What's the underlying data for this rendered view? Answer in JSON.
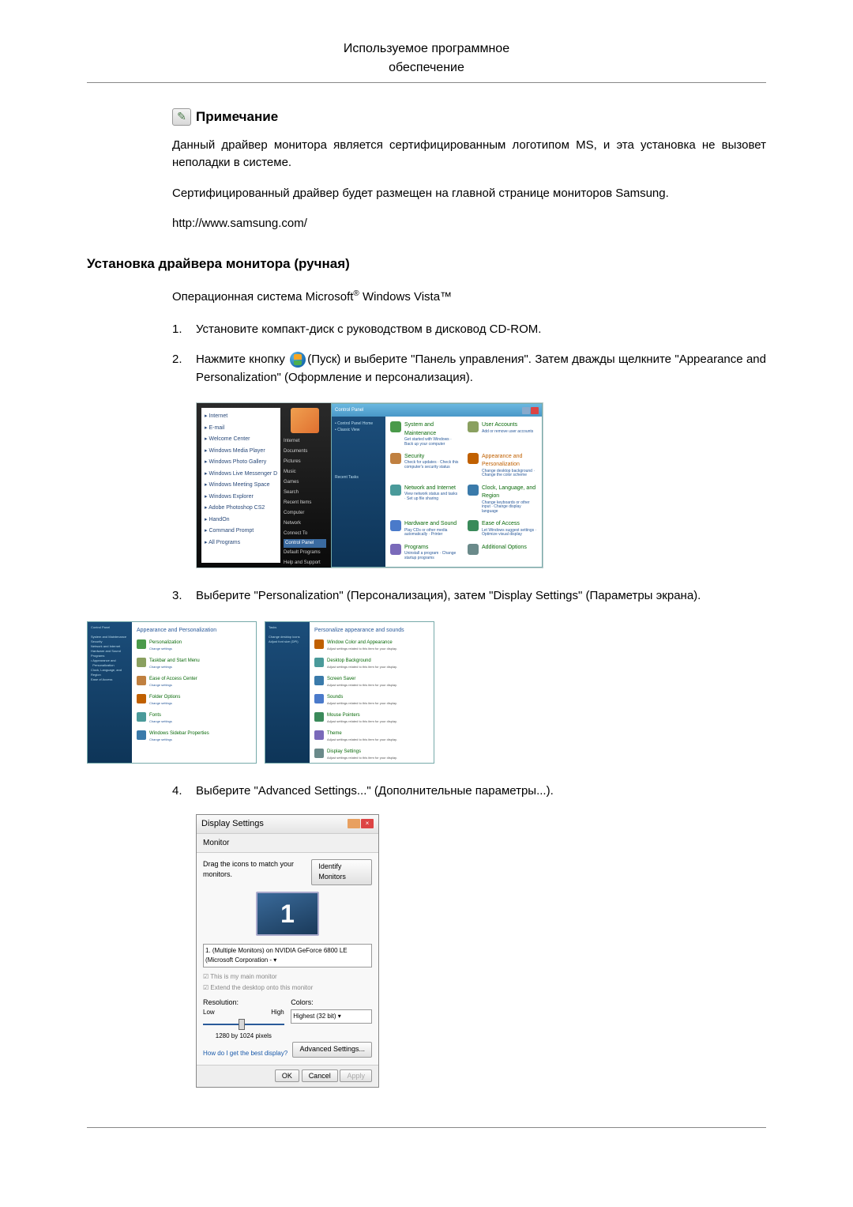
{
  "header": {
    "line1": "Используемое программное",
    "line2": "обеспечение"
  },
  "note": {
    "heading": "Примечание",
    "icon_glyph": "✎",
    "p1": "Данный драйвер монитора является сертифицированным логотипом MS, и эта установка не вызовет неполадки в системе.",
    "p2": "Сертифицированный драйвер будет размещен на главной странице мониторов Samsung.",
    "url": "http://www.samsung.com/"
  },
  "section_title": "Установка драйвера монитора (ручная)",
  "os_line_pre": "Операционная система Microsoft",
  "os_reg": "®",
  "os_line_mid": " Windows Vista™",
  "steps": {
    "s1": {
      "num": "1.",
      "text": "Установите компакт-диск с руководством в дисковод CD-ROM."
    },
    "s2": {
      "num": "2.",
      "pre": "Нажмите кнопку ",
      "post": "(Пуск) и выберите \"Панель управления\". Затем дважды щелкните \"Appearance and Personalization\" (Оформление и персонализация)."
    },
    "s3": {
      "num": "3.",
      "text": "Выберите \"Personalization\" (Персонализация), затем \"Display Settings\" (Параметры экрана)."
    },
    "s4": {
      "num": "4.",
      "text": "Выберите \"Advanced Settings...\" (Дополнительные параметры...)."
    }
  },
  "startmenu_shot": {
    "left_items": [
      "Internet",
      "E-mail",
      "Welcome Center",
      "Windows Media Player",
      "Windows Photo Gallery",
      "Windows Live Messenger Download",
      "Windows Meeting Space",
      "Windows Explorer",
      "Adobe Photoshop CS2",
      "HandOn",
      "Command Prompt",
      "All Programs"
    ],
    "right_items": [
      "Internet",
      "Documents",
      "Pictures",
      "Music",
      "Games",
      "Search",
      "Recent Items",
      "Computer",
      "Network",
      "Connect To",
      "Control Panel",
      "Default Programs",
      "Help and Support"
    ],
    "cp_title": "Control Panel",
    "cats": [
      {
        "t": "System and Maintenance",
        "sub": "Get started with Windows · Back up your computer"
      },
      {
        "t": "User Accounts",
        "sub": "Add or remove user accounts"
      },
      {
        "t": "Security",
        "sub": "Check for updates · Check this computer's security status"
      },
      {
        "t": "Appearance and Personalization",
        "sub": "Change desktop background · Change the color scheme",
        "hi": true
      },
      {
        "t": "Network and Internet",
        "sub": "View network status and tasks · Set up file sharing"
      },
      {
        "t": "Clock, Language, and Region",
        "sub": "Change keyboards or other input · Change display language"
      },
      {
        "t": "Hardware and Sound",
        "sub": "Play CDs or other media automatically · Printer"
      },
      {
        "t": "Ease of Access",
        "sub": "Let Windows suggest settings · Optimize visual display"
      },
      {
        "t": "Programs",
        "sub": "Uninstall a program · Change startup programs"
      },
      {
        "t": "Additional Options",
        "sub": ""
      }
    ]
  },
  "pers_shot": {
    "left_title": "Appearance and Personalization",
    "left_items": [
      "Personalization",
      "Taskbar and Start Menu",
      "Ease of Access Center",
      "Folder Options",
      "Fonts",
      "Windows Sidebar Properties"
    ],
    "right_title": "Personalize appearance and sounds",
    "right_items": [
      "Window Color and Appearance",
      "Desktop Background",
      "Screen Saver",
      "Sounds",
      "Mouse Pointers",
      "Theme",
      "Display Settings"
    ]
  },
  "ds": {
    "title": "Display Settings",
    "tab": "Monitor",
    "instr": "Drag the icons to match your monitors.",
    "identify": "Identify Monitors",
    "mon_num": "1",
    "combo": "1. (Multiple Monitors) on NVIDIA GeForce 6800 LE (Microsoft Corporation - ▾",
    "chk1": "☑ This is my main monitor",
    "chk2": "☑ Extend the desktop onto this monitor",
    "res_label": "Resolution:",
    "low": "Low",
    "high": "High",
    "res_val": "1280 by 1024 pixels",
    "colors_label": "Colors:",
    "colors_val": "Highest (32 bit)   ▾",
    "link": "How do I get the best display?",
    "adv": "Advanced Settings...",
    "ok": "OK",
    "cancel": "Cancel",
    "apply": "Apply"
  }
}
